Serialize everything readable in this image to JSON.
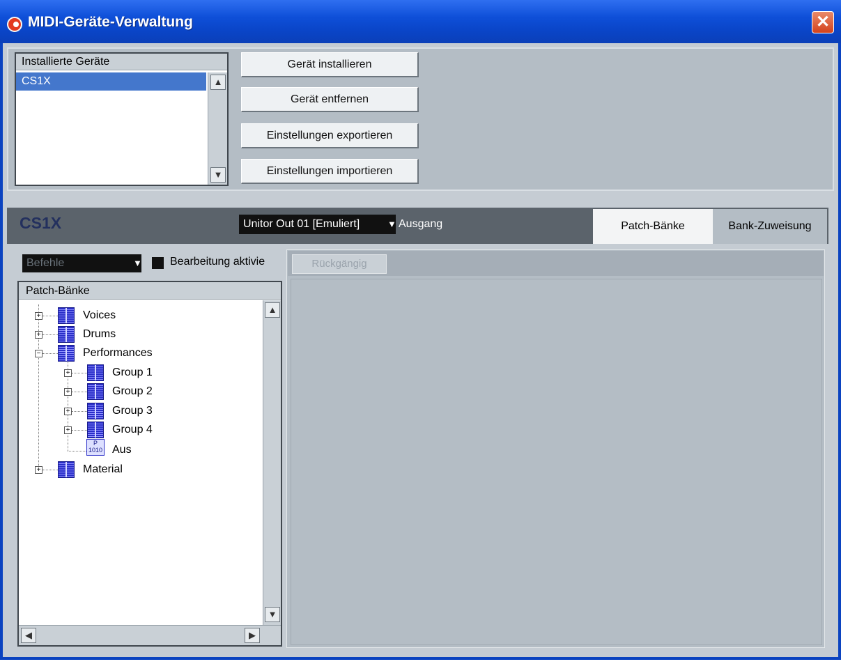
{
  "window": {
    "title": "MIDI-Geräte-Verwaltung",
    "close_symbol": "✕"
  },
  "installed": {
    "header": "Installierte Geräte",
    "devices": [
      "CS1X"
    ]
  },
  "actions": {
    "install": "Gerät installieren",
    "remove": "Gerät entfernen",
    "export": "Einstellungen exportieren",
    "import": "Einstellungen importieren"
  },
  "device": {
    "name": "CS1X",
    "port": "Unitor Out 01 [Emuliert]",
    "port_label": "Ausgang",
    "tabs": {
      "patch_banks": "Patch-Bänke",
      "bank_assign": "Bank-Zuweisung"
    }
  },
  "left": {
    "commands_placeholder": "Befehle",
    "edit_label": "Bearbeitung aktivie",
    "tree_header": "Patch-Bänke"
  },
  "tree": {
    "voices": "Voices",
    "drums": "Drums",
    "performances": "Performances",
    "group1": "Group 1",
    "group2": "Group 2",
    "group3": "Group 3",
    "group4": "Group 4",
    "aus": "Aus",
    "material": "Material",
    "prog_icon_top": "P",
    "prog_icon_bottom": "1010"
  },
  "right": {
    "undo": "Rückgängig"
  },
  "icons": {
    "scroll_up": "▲",
    "scroll_down": "▼",
    "scroll_left": "◀",
    "scroll_right": "▶",
    "dropdown": "▼",
    "plus": "+",
    "minus": "−"
  }
}
